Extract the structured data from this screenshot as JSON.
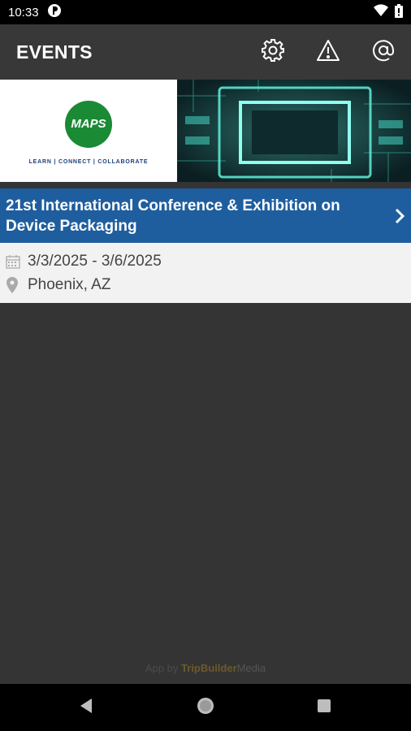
{
  "status_bar": {
    "time": "10:33"
  },
  "app_bar": {
    "title": "EVENTS",
    "actions": [
      "gear-icon",
      "warning-icon",
      "at-icon"
    ]
  },
  "banner": {
    "logo_text": "MAPS",
    "tagline": "LEARN  |  CONNECT  |  COLLABORATE"
  },
  "event": {
    "title": "21st International Conference & Exhibition on Device Packaging",
    "dates": "3/3/2025 - 3/6/2025",
    "location": "Phoenix, AZ"
  },
  "footer": {
    "prefix": "App by",
    "brand_a": "TripBuilder",
    "brand_b": "Media"
  },
  "colors": {
    "background": "#343434",
    "app_bar": "#383838",
    "event_header": "#1f5e9e",
    "details_bg": "#f2f2f2",
    "logo_green": "#1a8a35"
  }
}
